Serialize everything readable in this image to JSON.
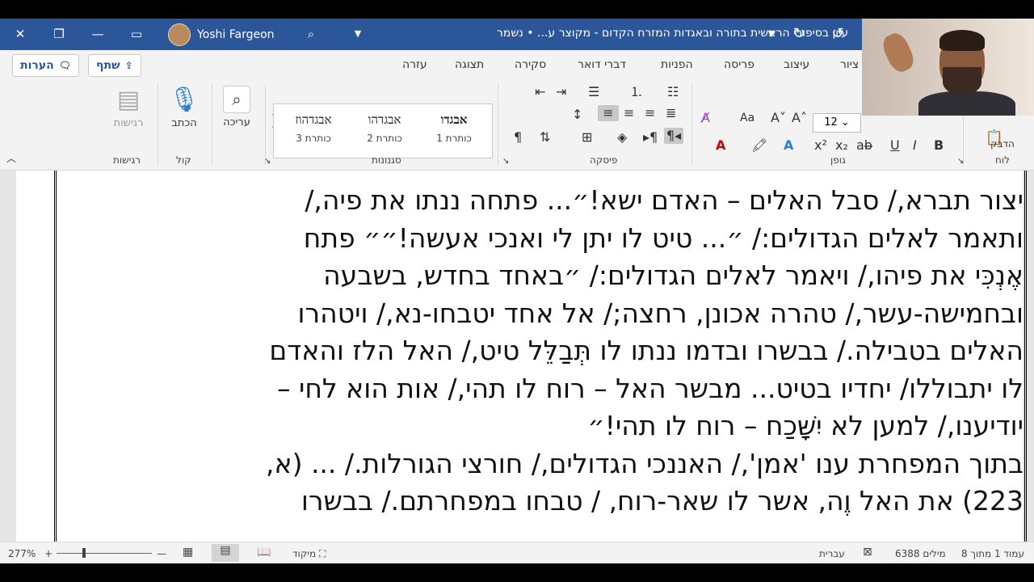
{
  "titlebar": {
    "user_name": "Yoshi Fargeon",
    "document_title": "עיון בסיפורי הראשית בתורה ובאגדות המזרח הקדום - מקוצר ע...  •  נשמר",
    "bg_color": "#2b579a"
  },
  "tabs": {
    "comments_label": "הערות",
    "share_label": "שתף",
    "items": [
      "ציור",
      "עיצוב",
      "פריסה",
      "הפניות",
      "דברי דואר",
      "סקירה",
      "תצוגה",
      "עזרה"
    ]
  },
  "ribbon": {
    "font_size": "12",
    "groups": {
      "clipboard": "לוח",
      "font": "גופן",
      "paragraph": "פיסקה",
      "styles": "סגנונות",
      "voice": "קול",
      "sensitivity": "רגישות"
    },
    "paste_label": "הדבק",
    "dictate_label": "הכתב",
    "editing_label": "עריכה",
    "sensitivity_label": "רגישות",
    "styles": [
      {
        "sample": "אבגדו",
        "name": "כותרת 1"
      },
      {
        "sample": "אבגדהו",
        "name": "כותרת 2"
      },
      {
        "sample": "אבגדהוז",
        "name": "כותרת 3"
      }
    ]
  },
  "document": {
    "lines": [
      "יצור תברא,/ סבל האלים – האדם ישא!״... פתחה ננתו את פיה,/",
      "ותאמר לאלים הגדולים:/ ״... טיט לו יתן לי ואנכי אעשה!״״ פתח",
      "אֶנְכִּי את פיהו,/ ויאמר לאלים הגדולים:/ ״באחד בחדש, בשבעה",
      "ובחמישה-עשר,/ טהרה אכונן, רחצה;/ אל אחד יטבחו-נא,/ ויטהרו",
      "האלים בטבילה./ בבשרו ובדמו ננתו לו תְּבַלֵּל טיט,/ האל הלז והאדם",
      "לו יתבוללו/ יחדיו בטיט... מבשר האל – רוח לו תהי,/ אות הוא לחי –",
      "יודיענו,/ למען לא יִשָּׁכַח – רוח לו תהי!״",
      "בתוך המפחרת ענו 'אמן',/ האננכי הגדולים,/ חורצי הגורלות./ ... (א,",
      "223) את האל וֶה, אשר לו שאר-רוח, / טבחו במפחרתם./ בבשרו"
    ]
  },
  "statusbar": {
    "page_info": "עמוד 1 מתוך 8",
    "word_count": "6388 מילים",
    "language": "עברית",
    "focus_label": "מיקוד",
    "zoom": "277%"
  }
}
